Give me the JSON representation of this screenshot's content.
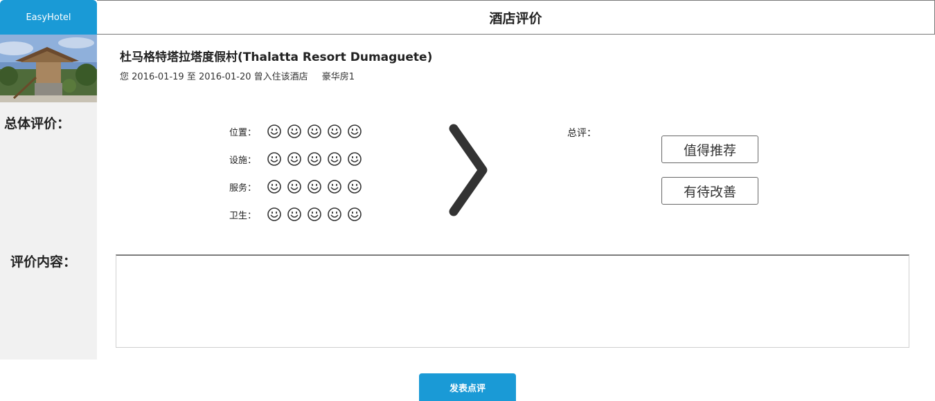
{
  "header": {
    "logo_text": "EasyHotel",
    "page_title": "酒店评价"
  },
  "hotel": {
    "name": "杜马格特塔拉塔度假村(Thalatta Resort Dumaguete)",
    "stay_text": "您 2016-01-19 至 2016-01-20 曾入住该酒店",
    "room": "豪华房1"
  },
  "sidebar": {
    "overall_label": "总体评价：",
    "content_label": "评价内容："
  },
  "ratings": [
    {
      "label": "位置：",
      "faces": 5
    },
    {
      "label": "设施：",
      "faces": 5
    },
    {
      "label": "服务：",
      "faces": 5
    },
    {
      "label": "卫生：",
      "faces": 5
    }
  ],
  "overall": {
    "label": "总评：",
    "options": [
      "值得推荐",
      "有待改善"
    ]
  },
  "review": {
    "value": "",
    "placeholder": ""
  },
  "submit_label": "发表点评",
  "colors": {
    "accent": "#1a9ad6",
    "sidebar_bg": "#f1f1f1",
    "icon": "#333333"
  }
}
